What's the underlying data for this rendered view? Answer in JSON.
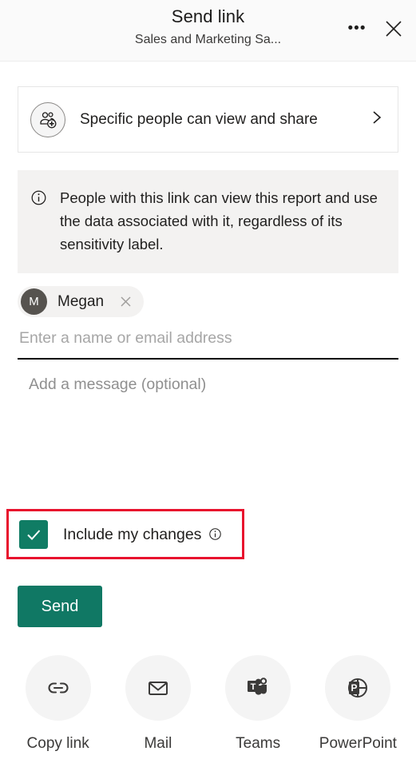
{
  "header": {
    "title": "Send link",
    "subtitle": "Sales and Marketing Sa...",
    "more_label": "•••",
    "more_icon": "ellipsis-icon",
    "close_icon": "close-icon"
  },
  "permission": {
    "icon": "people-add-icon",
    "label": "Specific people can view and share",
    "chevron_icon": "chevron-right-icon"
  },
  "info_banner": {
    "icon": "info-icon",
    "text": "People with this link can view this report and use the data associated with it, regardless of its sensitivity label."
  },
  "recipients": {
    "pills": [
      {
        "initial": "M",
        "name": "Megan",
        "remove_icon": "close-icon",
        "avatar_color": "#56534f"
      }
    ],
    "input_placeholder": "Enter a name or email address",
    "input_value": ""
  },
  "message": {
    "placeholder": "Add a message (optional)",
    "value": ""
  },
  "include_changes": {
    "label": "Include my changes",
    "checked": true,
    "check_icon": "checkmark-icon",
    "info_icon": "info-icon",
    "checkbox_color": "#107c64",
    "highlight_color": "#e8112d"
  },
  "send": {
    "label": "Send",
    "color": "#107864"
  },
  "share_actions": [
    {
      "label": "Copy link",
      "icon": "link-icon"
    },
    {
      "label": "Mail",
      "icon": "envelope-icon"
    },
    {
      "label": "Teams",
      "icon": "teams-icon"
    },
    {
      "label": "PowerPoint",
      "icon": "powerpoint-icon"
    }
  ]
}
